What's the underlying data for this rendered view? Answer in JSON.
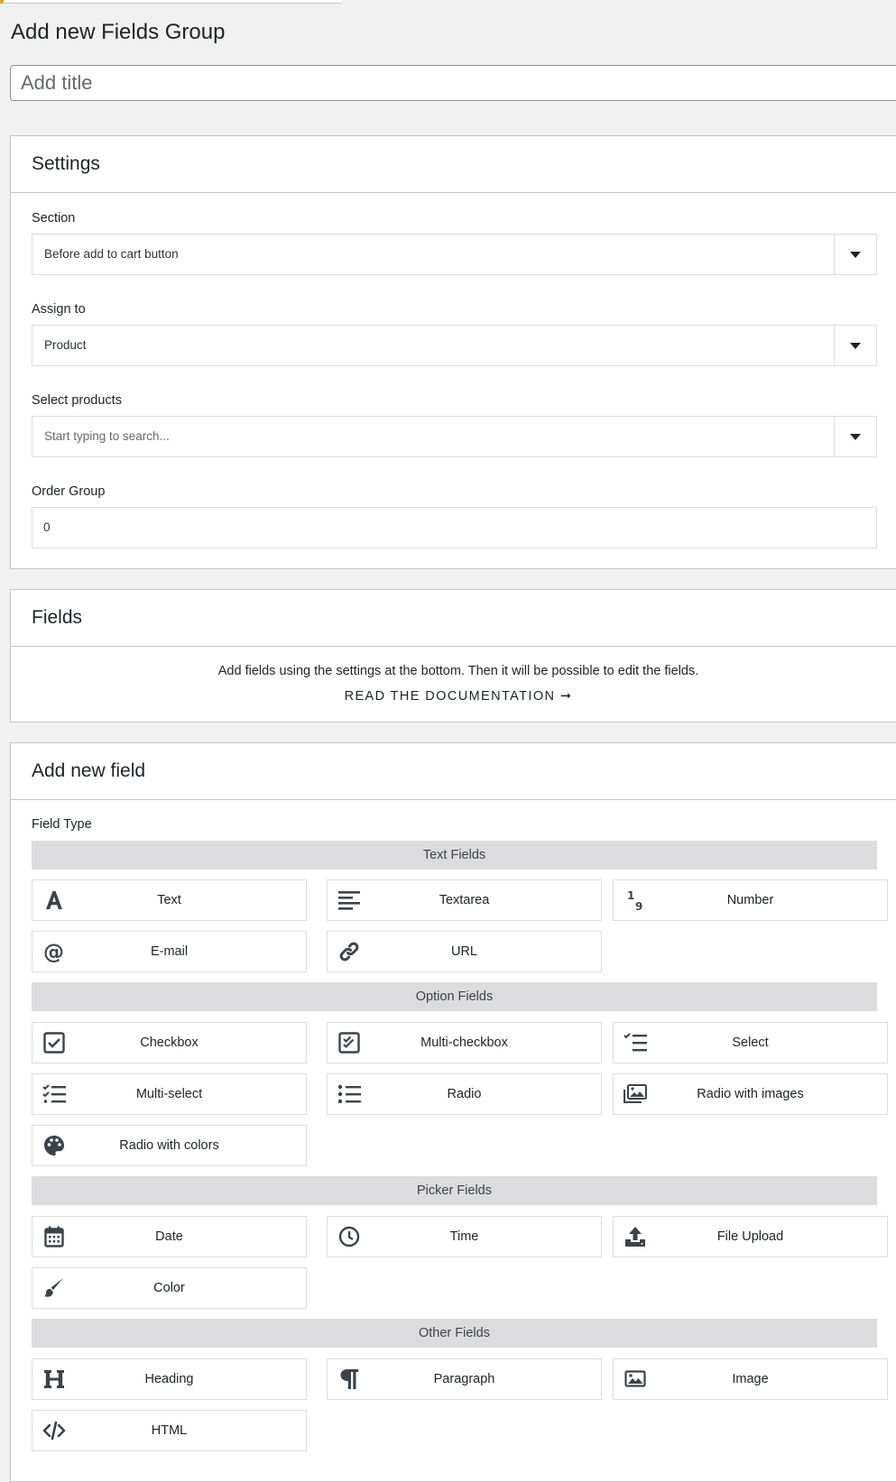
{
  "page": {
    "title": "Add new Fields Group"
  },
  "title_input": {
    "placeholder": "Add title",
    "value": ""
  },
  "settings": {
    "header": "Settings",
    "section": {
      "label": "Section",
      "value": "Before add to cart button"
    },
    "assign_to": {
      "label": "Assign to",
      "value": "Product"
    },
    "select_products": {
      "label": "Select products",
      "placeholder": "Start typing to search..."
    },
    "order_group": {
      "label": "Order Group",
      "value": "0"
    }
  },
  "fields": {
    "header": "Fields",
    "message": "Add fields using the settings at the bottom. Then it will be possible to edit the fields.",
    "doc_link": "READ THE DOCUMENTATION ➞"
  },
  "add_new_field": {
    "header": "Add new field",
    "field_type_label": "Field Type",
    "groups": [
      {
        "label": "Text Fields",
        "items": [
          {
            "label": "Text",
            "icon": "text-icon"
          },
          {
            "label": "Textarea",
            "icon": "textarea-icon"
          },
          {
            "label": "Number",
            "icon": "number-icon"
          },
          {
            "label": "E-mail",
            "icon": "email-icon"
          },
          {
            "label": "URL",
            "icon": "link-icon"
          }
        ]
      },
      {
        "label": "Option Fields",
        "items": [
          {
            "label": "Checkbox",
            "icon": "checkbox-icon"
          },
          {
            "label": "Multi-checkbox",
            "icon": "multi-checkbox-icon"
          },
          {
            "label": "Select",
            "icon": "select-list-icon"
          },
          {
            "label": "Multi-select",
            "icon": "multi-select-icon"
          },
          {
            "label": "Radio",
            "icon": "radio-list-icon"
          },
          {
            "label": "Radio with images",
            "icon": "images-icon"
          },
          {
            "label": "Radio with colors",
            "icon": "palette-icon"
          }
        ]
      },
      {
        "label": "Picker Fields",
        "items": [
          {
            "label": "Date",
            "icon": "calendar-icon"
          },
          {
            "label": "Time",
            "icon": "clock-icon"
          },
          {
            "label": "File Upload",
            "icon": "upload-icon"
          },
          {
            "label": "Color",
            "icon": "brush-icon"
          }
        ]
      },
      {
        "label": "Other Fields",
        "items": [
          {
            "label": "Heading",
            "icon": "heading-icon"
          },
          {
            "label": "Paragraph",
            "icon": "paragraph-icon"
          },
          {
            "label": "Image",
            "icon": "image-icon"
          },
          {
            "label": "HTML",
            "icon": "code-icon"
          }
        ]
      }
    ]
  }
}
